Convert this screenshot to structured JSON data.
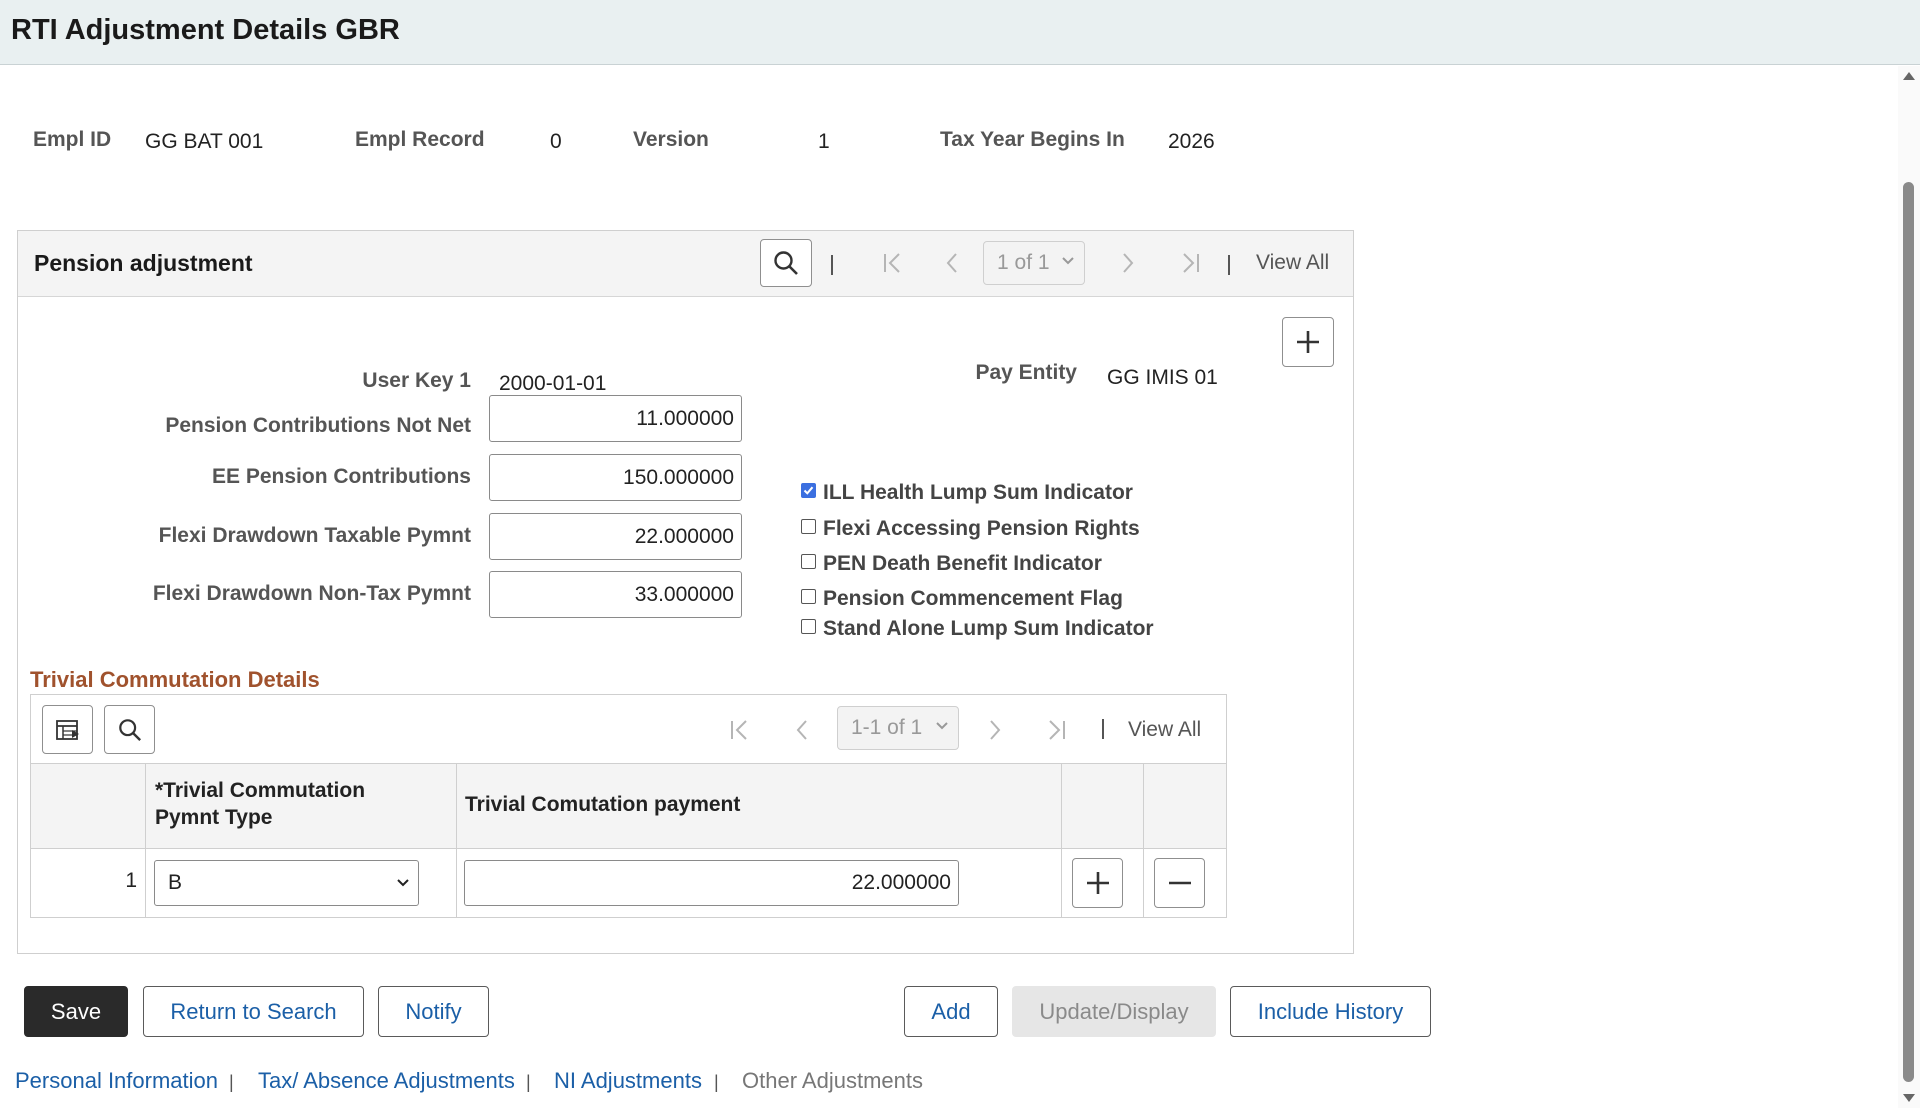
{
  "page": {
    "title": "RTI Adjustment Details GBR"
  },
  "keys": {
    "empl_id_label": "Empl ID",
    "empl_id": "GG BAT 001",
    "empl_record_label": "Empl Record",
    "empl_record": "0",
    "version_label": "Version",
    "version": "1",
    "tax_year_label": "Tax Year Begins In",
    "tax_year": "2026"
  },
  "pension": {
    "title": "Pension adjustment",
    "pager": "1 of 1",
    "view_all": "View All",
    "user_key_label": "User Key 1",
    "user_key": "2000-01-01",
    "pay_entity_label": "Pay Entity",
    "pay_entity": "GG IMIS 01",
    "fields": [
      {
        "label": "Pension Contributions Not Net",
        "value": "11.000000"
      },
      {
        "label": "EE Pension Contributions",
        "value": "150.000000"
      },
      {
        "label": "Flexi Drawdown Taxable Pymnt",
        "value": "22.000000"
      },
      {
        "label": "Flexi Drawdown Non-Tax Pymnt",
        "value": "33.000000"
      }
    ],
    "checkboxes": [
      {
        "label": "ILL Health Lump Sum Indicator",
        "checked": true
      },
      {
        "label": "Flexi Accessing Pension Rights",
        "checked": false
      },
      {
        "label": "PEN Death Benefit Indicator",
        "checked": false
      },
      {
        "label": "Pension Commencement Flag",
        "checked": false
      },
      {
        "label": "Stand Alone Lump Sum Indicator",
        "checked": false
      }
    ]
  },
  "trivial": {
    "title": "Trivial Commutation Details",
    "pager": "1-1 of 1",
    "view_all": "View All",
    "col_type_line1": "*Trivial Commutation",
    "col_type_line2": "Pymnt Type",
    "col_payment": "Trivial Comutation payment",
    "rows": [
      {
        "num": "1",
        "type": "B",
        "payment": "22.000000"
      }
    ]
  },
  "buttons": {
    "save": "Save",
    "return": "Return to Search",
    "notify": "Notify",
    "add": "Add",
    "update": "Update/Display",
    "history": "Include History"
  },
  "nav": {
    "personal": "Personal Information",
    "tax": "Tax/ Absence Adjustments",
    "ni": "NI Adjustments",
    "other": "Other Adjustments",
    "separator": "|"
  },
  "colors": {
    "link": "#1b5fa7",
    "section_title": "#a0522d",
    "checkbox": "#3b6fe0"
  },
  "icons": [
    "search-icon",
    "first-page-icon",
    "previous-icon",
    "next-icon",
    "last-page-icon",
    "add-icon",
    "remove-icon",
    "personalize-grid-icon",
    "chevron-down-icon"
  ]
}
